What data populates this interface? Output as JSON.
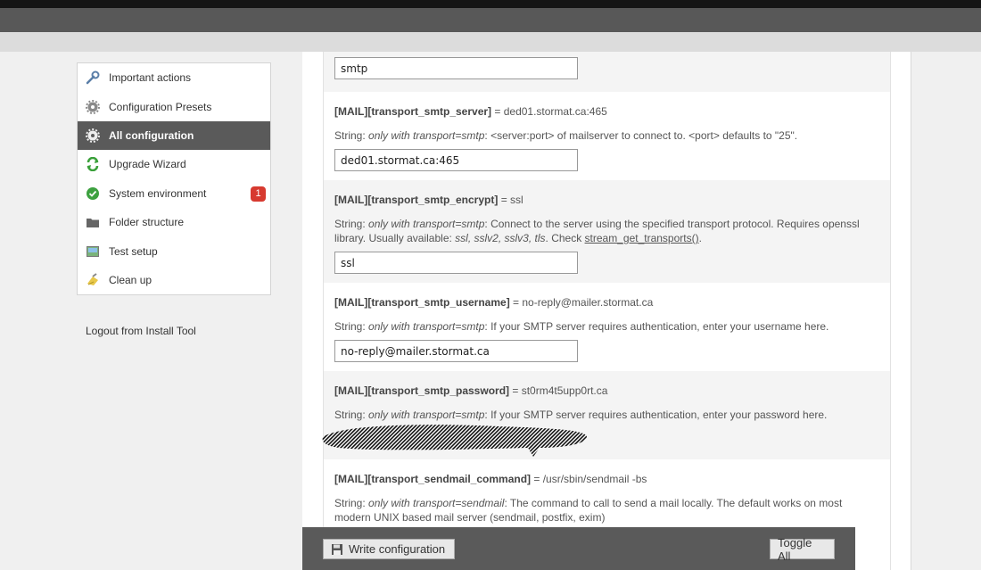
{
  "sidebar": {
    "items": [
      {
        "label": "Important actions",
        "icon": "wrench-icon"
      },
      {
        "label": "Configuration Presets",
        "icon": "gear-icon"
      },
      {
        "label": "All configuration",
        "icon": "gear-icon",
        "active": true
      },
      {
        "label": "Upgrade Wizard",
        "icon": "refresh-icon"
      },
      {
        "label": "System environment",
        "icon": "check-circle-icon",
        "badge": "1"
      },
      {
        "label": "Folder structure",
        "icon": "folder-icon"
      },
      {
        "label": "Test setup",
        "icon": "image-icon"
      },
      {
        "label": "Clean up",
        "icon": "broom-icon"
      }
    ],
    "logout_label": "Logout from Install Tool"
  },
  "config": {
    "top_value": "smtp",
    "smtp_server": {
      "key": "[MAIL][transport_smtp_server]",
      "eq": " = ded01.stormat.ca:465",
      "type": "String: ",
      "cond": "only with transport=smtp",
      "desc": ": <server:port> of mailserver to connect to. <port> defaults to \"25\".",
      "value": "ded01.stormat.ca:465"
    },
    "smtp_encrypt": {
      "key": "[MAIL][transport_smtp_encrypt]",
      "eq": " = ssl",
      "type": "String: ",
      "cond": "only with transport=smtp",
      "desc": ": Connect to the server using the specified transport protocol. Requires openssl library. Usually available: ",
      "avail": "ssl, sslv2, sslv3, tls",
      "desc2": ". Check ",
      "link": "stream_get_transports()",
      "desc3": ".",
      "value": "ssl"
    },
    "smtp_username": {
      "key": "[MAIL][transport_smtp_username]",
      "eq": " = no-reply@mailer.stormat.ca",
      "type": "String: ",
      "cond": "only with transport=smtp",
      "desc": ": If your SMTP server requires authentication, enter your username here.",
      "value": "no-reply@mailer.stormat.ca"
    },
    "smtp_password": {
      "key": "[MAIL][transport_smtp_password]",
      "eq": " = st0rm4t5upp0rt.ca",
      "type": "String: ",
      "cond": "only with transport=smtp",
      "desc": ": If your SMTP server requires authentication, enter your password here."
    },
    "sendmail_command": {
      "key": "[MAIL][transport_sendmail_command]",
      "eq": " = /usr/sbin/sendmail -bs",
      "type": "String: ",
      "cond": "only with transport=sendmail",
      "desc": ": The command to call to send a mail locally. The default works on most modern UNIX based mail server (sendmail, postfix, exim)"
    }
  },
  "footer": {
    "write_label": "Write configuration",
    "toggle_label": "Toggle All"
  }
}
